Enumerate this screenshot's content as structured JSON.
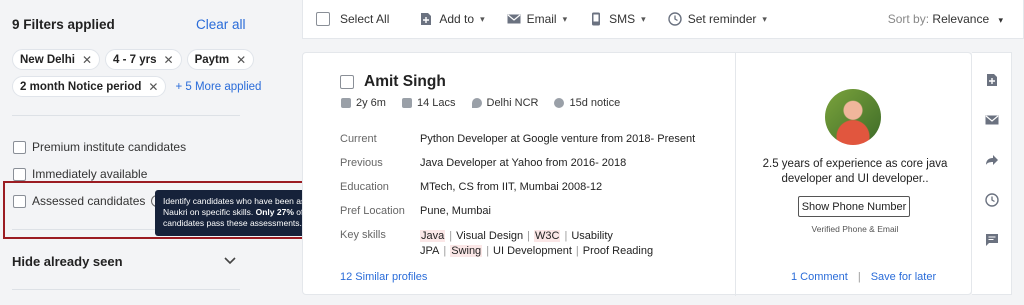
{
  "filters": {
    "heading": "9 Filters applied",
    "clear_all": "Clear all",
    "chips": [
      "New Delhi",
      "4 - 7 yrs",
      "Paytm",
      "2 month Notice period"
    ],
    "more_link": "+ 5 More applied",
    "checkboxes": [
      "Premium institute candidates",
      "Immediately available",
      "Assessed candidates"
    ],
    "tooltip_prefix": "Identify candidates who have been assessed by Naukri on specific skills.",
    "tooltip_bold": "Only 27%",
    "tooltip_suffix": "of the candidates pass these assessments.",
    "hide_seen": "Hide already seen"
  },
  "toolbar": {
    "select_all": "Select All",
    "add_to": "Add to",
    "email": "Email",
    "sms": "SMS",
    "set_reminder": "Set reminder",
    "sort_label": "Sort by:",
    "sort_value": "Relevance"
  },
  "candidate": {
    "name": "Amit Singh",
    "experience": "2y 6m",
    "salary": "14 Lacs",
    "location": "Delhi NCR",
    "notice": "15d notice",
    "current_label": "Current",
    "current": "Python Developer at Google venture from 2018- Present",
    "previous_label": "Previous",
    "previous": "Java Developer at Yahoo from 2016- 2018",
    "education_label": "Education",
    "education": "MTech, CS from IIT, Mumbai 2008-12",
    "pref_location_label": "Pref Location",
    "pref_location": "Pune, Mumbai",
    "skills_label": "Key skills",
    "skills": [
      "Java",
      "Visual Design",
      "W3C",
      "Usability",
      "JPA",
      "Swing",
      "UI Development",
      "Proof Reading"
    ],
    "similar": "12 Similar profiles",
    "summary": "2.5 years of experience as core java developer and UI developer..",
    "phone_button": "Show Phone Number",
    "verified": "Verified Phone & Email",
    "comment_link": "1 Comment",
    "save_link": "Save for later"
  },
  "colors": {
    "accent": "#2a6cd9",
    "highlight_border": "#9b1c22",
    "tooltip_bg": "#16223a"
  }
}
